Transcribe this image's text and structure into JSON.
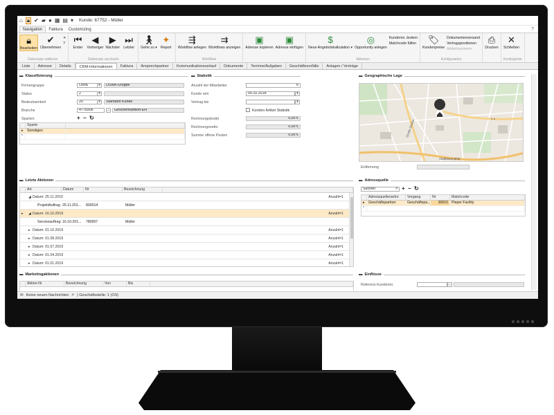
{
  "window": {
    "title": "Kunde: 67752 - Müller"
  },
  "ribbon_tabs": [
    "Navigation",
    "Faktura",
    "Customizing"
  ],
  "ribbon": {
    "groups": [
      {
        "name": "Datensatz editieren",
        "buttons": [
          "Bearbeiten",
          "Übernehmen"
        ]
      },
      {
        "name": "Datensatz wechseln",
        "buttons": [
          "Erster",
          "Vorheriger",
          "Nächster",
          "Letzter"
        ]
      },
      {
        "name": "",
        "buttons": [
          "Gehe zu ▾",
          "Report"
        ]
      },
      {
        "name": "Workflow",
        "buttons": [
          "Workflow anlegen",
          "Workflows anzeigen"
        ]
      },
      {
        "name": "",
        "buttons": [
          "Adresse kopieren",
          "Adresse einfügen"
        ]
      },
      {
        "name": "Aktionen",
        "buttons": [
          "Neue Angebotskalkulation ▾",
          "Opportunity anlegen"
        ],
        "small": [
          "Kundennr. ändern",
          "Matchcode füllen"
        ]
      },
      {
        "name": "Konfiguration",
        "buttons": [
          "Kundenpreise"
        ],
        "small": [
          "Dokumentenversand",
          "Vertragspositionen",
          "Artikelnummern"
        ]
      },
      {
        "name": "",
        "buttons": [
          "Drucken"
        ]
      },
      {
        "name": "Kontingente",
        "buttons": [
          "Schließen"
        ]
      }
    ]
  },
  "tabs": [
    "Liste",
    "Adresse",
    "Details",
    "CRM-Informationen",
    "Faktura",
    "Ansprechpartner",
    "Kommunikationsverlauf",
    "Dokumente",
    "Termine/Aufgaben",
    "Geschäftsvorfälle",
    "Anlagen / Verträge"
  ],
  "klassifizierung": {
    "heading": "Klassifizierung",
    "rows": [
      {
        "label": "Firmengruppe",
        "value": "Osna",
        "desc": "OSNA-Gruppe"
      },
      {
        "label": "Status",
        "value": "2",
        "desc": ""
      },
      {
        "label": "Bedeutsamkeit",
        "value": "20",
        "desc": "Standard Kunde"
      },
      {
        "label": "Branche",
        "value": "4778306",
        "desc": "Geschenkartikel-EH"
      }
    ],
    "sparten_label": "Sparten",
    "sparten_header": "Sparte",
    "sparten_rows": [
      "Sonstiges"
    ]
  },
  "statistik": {
    "heading": "Statistik",
    "rows": [
      {
        "label": "Anzahl der Mitarbeiter",
        "value": "6"
      },
      {
        "label": "Kunde seit",
        "value": "05.10.2018"
      },
      {
        "label": "Vertrag bis",
        "value": ""
      }
    ],
    "checkbox_label": "Kunden Artikel Statistik",
    "money": [
      {
        "label": "Rechnungsbrutto",
        "value": "0,00 €"
      },
      {
        "label": "Rechnungsnetto",
        "value": "0,00 €"
      },
      {
        "label": "Summe offene Posten",
        "value": "0,00 €"
      }
    ]
  },
  "geo": {
    "heading": "Geographische Lage",
    "map_labels": {
      "road1": "Große Straße",
      "place": "Stadtbaumpfad",
      "road2": "K 6"
    },
    "entfernung_label": "Entfernung"
  },
  "aktionen": {
    "heading": "Letzte Aktionen",
    "columns": [
      "Art",
      "Datum",
      "Nr",
      "Bezeichnung"
    ],
    "groups": [
      {
        "label": "Datum: 25.11.2019",
        "count": "Anzahl=1",
        "row": {
          "art": "ProjektAuftrag",
          "datum": "25.11.201...",
          "nr": "800014",
          "bez": "Müller"
        }
      },
      {
        "label": "Datum: 16.10.2019",
        "count": "Anzahl=1",
        "row": {
          "art": "Serviceauftrag",
          "datum": "16.10.201...",
          "nr": "780007",
          "bez": "Müller"
        }
      },
      {
        "label": "Datum: 01.10.2019",
        "count": "Anzahl=1"
      },
      {
        "label": "Datum: 01.08.2019",
        "count": "Anzahl=1"
      },
      {
        "label": "Datum: 01.07.2019",
        "count": "Anzahl=1"
      },
      {
        "label": "Datum: 01.04.2019",
        "count": "Anzahl=1"
      },
      {
        "label": "Datum: 01.01.2019",
        "count": "Anzahl=1"
      }
    ]
  },
  "adressquelle": {
    "heading": "Adressquelle",
    "search_placeholder": "Suchen",
    "columns": [
      "Adressquellenartnr.",
      "Vorgang",
      "Nr",
      "Matchcode"
    ],
    "row": {
      "art": "Geschäftspartner",
      "vorgang": "Geschäftspa...",
      "nr": "30010",
      "match": "Pieper Facility"
    }
  },
  "marketing": {
    "heading": "Marketingaktionen",
    "columns": [
      "Aktion-Nr",
      "Bezeichnung",
      "Von",
      "Bis"
    ]
  },
  "einfluesse": {
    "heading": "Einflüsse",
    "referenz_label": "Referenz-Kundennr."
  },
  "statusbar": {
    "messages": "Keine neuen Nachrichten",
    "office": "| Geschäftsstelle:  1 (OS)"
  }
}
